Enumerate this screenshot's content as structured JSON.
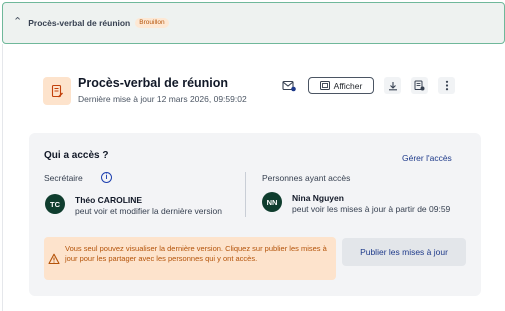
{
  "accordion": {
    "title": "Procès-verbal de réunion",
    "badge": "Brouillon"
  },
  "document": {
    "title": "Procès-verbal de réunion",
    "last_update": "Dernière mise à jour 12 mars 2026, 09:59:02"
  },
  "toolbar": {
    "view_label": "Afficher"
  },
  "access": {
    "title": "Qui a accès ?",
    "manage_label": "Gérer l'accès",
    "secretary": {
      "label": "Secrétaire",
      "initials": "TC",
      "name": "Théo CAROLINE",
      "permission": "peut voir et modifier la dernière version"
    },
    "people": {
      "label": "Personnes ayant accès",
      "initials": "NN",
      "name": "Nina Nguyen",
      "permission": "peut voir les mises à jour à partir de 09:59"
    },
    "warning": "Vous seul pouvez visualiser la dernière version. Cliquez sur publier les mises à jour pour les partager avec les personnes qui y ont accès.",
    "publish_label": "Publier les mises à jour"
  },
  "colors": {
    "accent": "#6fb89a",
    "avatar": "#0f3d2e",
    "warning_bg": "#fde3cc",
    "warning_text": "#b45309",
    "link": "#1e3a8a"
  }
}
